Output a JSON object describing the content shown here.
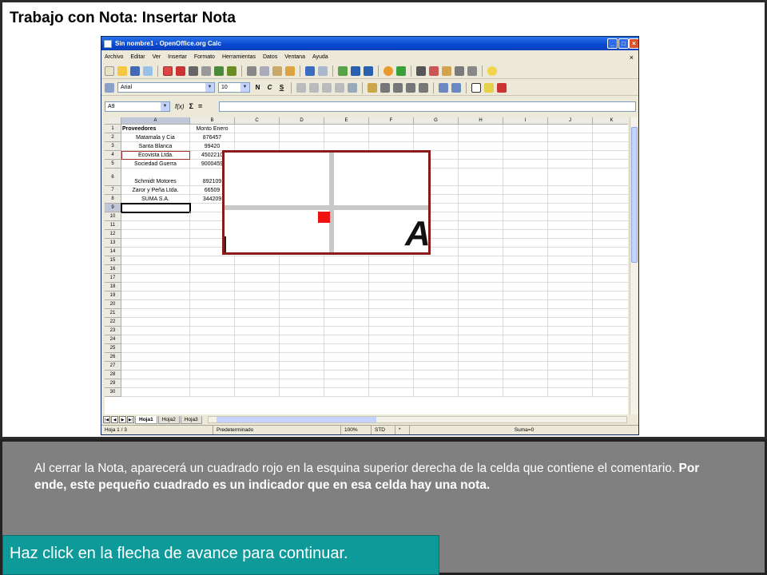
{
  "slide": {
    "title": "Trabajo con Nota: Insertar Nota",
    "description_normal": "Al cerrar la Nota, aparecerá un cuadrado rojo en la esquina superior derecha de la celda que contiene el comentario. ",
    "description_bold": "Por ende, este pequeño cuadrado es un indicador que en esa celda hay una nota.",
    "cta": "Haz click en la flecha de avance para continuar."
  },
  "window": {
    "title": "Sin nombre1 - OpenOffice.org Calc",
    "menu": [
      "Archivo",
      "Editar",
      "Ver",
      "Insertar",
      "Formato",
      "Herramientas",
      "Datos",
      "Ventana",
      "Ayuda"
    ],
    "close_doc": "×",
    "font_name": "Arial",
    "font_size": "10",
    "format_buttons": [
      "N",
      "C",
      "S"
    ],
    "name_box": "A9",
    "fx_label": "f(x)",
    "sigma_label": "Σ",
    "equals_label": "="
  },
  "grid": {
    "columns": [
      "A",
      "B",
      "C",
      "D",
      "E",
      "F",
      "G",
      "H",
      "I",
      "J",
      "K"
    ],
    "rows": [
      {
        "n": "1",
        "a": "Proveedores",
        "b": "Monto Enero"
      },
      {
        "n": "2",
        "a": "Matamala y Cia",
        "b": "876457"
      },
      {
        "n": "3",
        "a": "Santa Blanca",
        "b": "99420"
      },
      {
        "n": "4",
        "a": "Ecovista Ltda.",
        "b": "4502210"
      },
      {
        "n": "5",
        "a": "Sociedad Guerra",
        "b": "9000459"
      },
      {
        "n": "6",
        "a": "Schmidt Motores",
        "b": "892109"
      },
      {
        "n": "7",
        "a": "Zaror y Peña Ltda.",
        "b": "66509"
      },
      {
        "n": "8",
        "a": "SUMA S.A.",
        "b": "344209"
      },
      {
        "n": "9",
        "a": "",
        "b": ""
      },
      {
        "n": "10"
      },
      {
        "n": "11"
      },
      {
        "n": "12"
      },
      {
        "n": "13"
      },
      {
        "n": "14"
      },
      {
        "n": "15"
      },
      {
        "n": "16"
      },
      {
        "n": "17"
      },
      {
        "n": "18"
      },
      {
        "n": "19"
      },
      {
        "n": "20"
      },
      {
        "n": "21"
      },
      {
        "n": "22"
      },
      {
        "n": "23"
      },
      {
        "n": "24"
      },
      {
        "n": "25"
      },
      {
        "n": "26"
      },
      {
        "n": "27"
      },
      {
        "n": "28"
      },
      {
        "n": "29"
      },
      {
        "n": "30"
      }
    ]
  },
  "tabs": [
    "Hoja1",
    "Hoja2",
    "Hoja3"
  ],
  "status": {
    "sheet": "Hoja 1 / 3",
    "style": "Predeterminado",
    "zoom": "100%",
    "mode": "STD",
    "mod": "*",
    "sum": "Suma=0"
  },
  "zoom_glyph": "A",
  "colors": {
    "note_indicator": "#f01010",
    "zoom_border": "#8b1a1a",
    "cta_bg": "#0f9a9a",
    "panel_bg": "#808080"
  }
}
